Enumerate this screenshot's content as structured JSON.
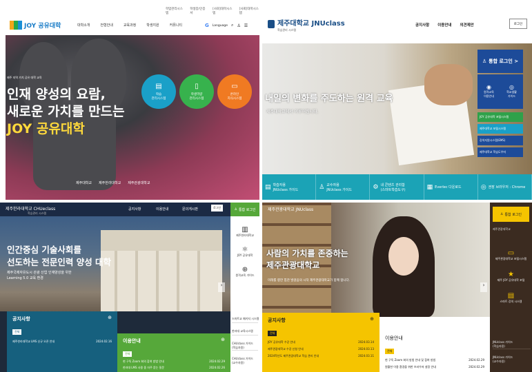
{
  "q1": {
    "util": [
      "학업관리시스템",
      "학생증/인증서",
      "[사회]대학시스템",
      "[사회]대학시스템"
    ],
    "logo": "JOY 공유대학",
    "nav": [
      "대학소개",
      "전형안내",
      "교육과정",
      "학생지원",
      "커뮤니티"
    ],
    "lang": "Language",
    "hero_small": "제주 지역 가치 공유 대학 교육",
    "title1": "인재 양성의 요람,",
    "title2": "새로운 가치를 만드는",
    "title3": "JOY 공유대학",
    "circles": [
      {
        "label": "학습\n관리시스템",
        "icon": "book-icon",
        "color": "#1aa0c8"
      },
      {
        "label": "학생역량\n관리시스템",
        "icon": "phone-icon",
        "color": "#37b24d"
      },
      {
        "label": "온라인\n지식시스템",
        "icon": "monitor-icon",
        "color": "#f07a22"
      }
    ],
    "partners": [
      "제주대학교",
      "제주한라대학교",
      "제주관광대학교"
    ]
  },
  "q2": {
    "logo": "제주대학교 JNUclass",
    "logo_sub": "학습관리 시스템",
    "nav": [
      "공지사항",
      "이용안내",
      "의견제안"
    ],
    "login_btn": "로그인",
    "title": "내일의 변화를 주도하는 원격 교육",
    "subtitle": "제주대학교에서 이루어집니다.",
    "login_panel": "통합 로그인 >",
    "login_icons": [
      "원격교육\n이용안내",
      "학교생활\n가이드"
    ],
    "quick_links": [
      "JOY 공유대학 포털시스템",
      "제주대학교 포털시스템",
      "강의지원시스템(EMS)",
      "제주대학교 학습도우미"
    ],
    "quick_colors": [
      "#2fa14a",
      "#1aa0c8",
      "#1d4b99",
      "#1d4b99"
    ],
    "bar": [
      "학습자용\nJNUclass 가이드",
      "교수자용\nJNUclass 가이드",
      "내 콘텐츠 관리함\n(스마트학습도구)",
      "Everlec 다운로드",
      "권장 브라우저 : Chrome"
    ]
  },
  "q3": {
    "logo": "제주한라대학교 CHUeclass",
    "logo_sub": "학습관리 시스템",
    "nav": [
      "공지사항",
      "이용안내",
      "문의게시판"
    ],
    "login_btn": "로그인",
    "title1": "인간중심 기술사회를",
    "title2": "선도하는 전문인력 양성 대학",
    "sub1": "제주국제자유도시 관광 산업 인재양성을 위한",
    "sub2": "Learning 5.0 교육 환경",
    "side_login": "통합 로그인",
    "side_items": [
      "제주한라대학교",
      "JOY 공유대학",
      "원격교육 가이드"
    ],
    "side_links": [
      "스마트교 패키지 시스템",
      "한라대 교육시스템",
      "CHUclass 가이드\n(학습자용)",
      "CHUclass 가이드\n(교수자용)"
    ],
    "notice_title": "공지사항",
    "notice_badge": "전체",
    "notice_row": "제주한라대학교 LMS 신규 오픈 안내",
    "notice_date": "2024.02.16",
    "guide_title": "이용안내",
    "guide_badge": "전체",
    "guide_rows": [
      [
        "현 구독 Zoom 회의 참여 방법 안내",
        "2024.02.29"
      ],
      [
        "한라대 LMS 사용 중 자주 묻는 질문",
        "2024.02.26"
      ]
    ]
  },
  "q4": {
    "logo": "제주관광대학교 JNUclass",
    "title1": "사람의 가치를 존중하는",
    "title2": "제주관광대학교",
    "sub": "미래를 향한 힘찬 발걸음의 시작 제주관광대학교가 함께 합니다.",
    "side_login": "통합 로그인",
    "side_sub": "제주관광대학교",
    "side_items": [
      "제주관광대학교 포털시스템",
      "제주 JOY 공유대학 포털",
      "스마트 강의 시스템"
    ],
    "side_links": [
      "JNUclass 가이드\n(학습자용)",
      "JNUclass 가이드\n(교수자용)"
    ],
    "notice_title": "공지사항",
    "notice_badge": "전체",
    "notice_rows": [
      [
        "JOY 공유대학 수강 안내",
        "2024.03.14"
      ],
      [
        "제주관광대학교 수강 신청 안내",
        "2024.03.13"
      ],
      [
        "2024학년도 제주관광대학교 학습 관리 안내",
        "2024.03.11"
      ]
    ],
    "guide_title": "이용안내",
    "guide_badge": "전체",
    "guide_rows": [
      [
        "현 구독 Zoom 회의 방법 안내 및 참여 방법",
        "2024.02.29"
      ],
      [
        "원활한 이용 환경을 위한 브라우저 설정 안내",
        "2024.02.29"
      ]
    ]
  }
}
